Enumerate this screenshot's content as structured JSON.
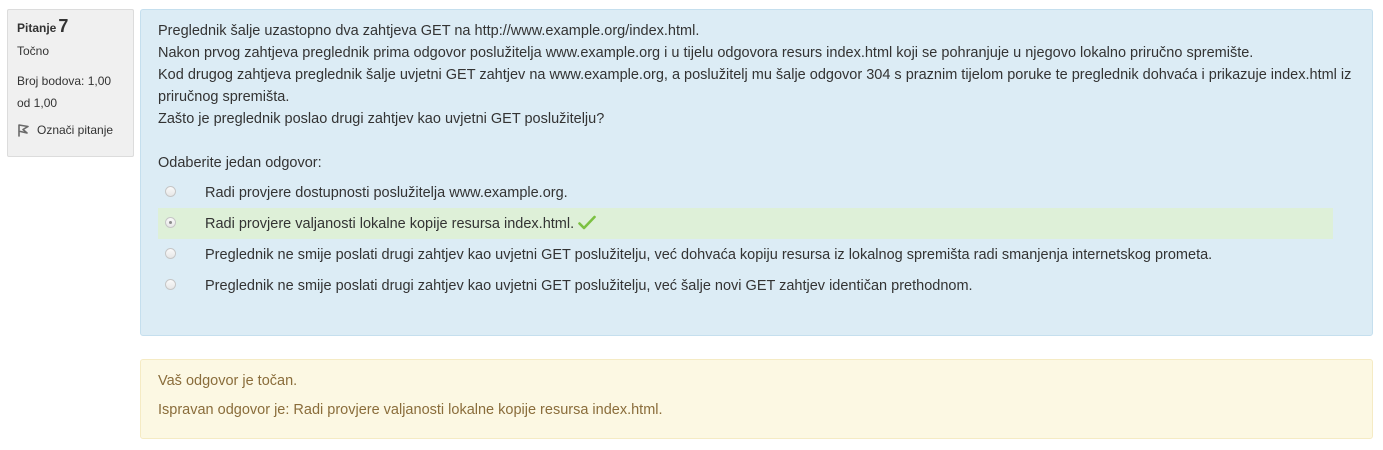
{
  "info": {
    "question_label": "Pitanje",
    "question_number": "7",
    "state": "Točno",
    "grade_line1": "Broj bodova: 1,00",
    "grade_line2": "od 1,00",
    "flag_label": "Označi pitanje",
    "flag_icon": "flag-icon"
  },
  "question": {
    "text_lines": [
      "Preglednik šalje uzastopno dva zahtjeva GET na http://www.example.org/index.html.",
      "Nakon prvog zahtjeva preglednik prima odgovor poslužitelja www.example.org i u tijelu odgovora resurs index.html koji se pohranjuje u njegovo lokalno priručno spremište.",
      "Kod drugog zahtjeva preglednik šalje uvjetni GET zahtjev na www.example.org, a poslužitelj mu šalje odgovor 304 s praznim tijelom poruke te preglednik dohvaća i prikazuje index.html iz priručnog spremišta.",
      "Zašto je preglednik poslao drugi zahtjev kao uvjetni GET poslužitelju?"
    ],
    "prompt": "Odaberite jedan odgovor:",
    "answers": [
      {
        "label": "Radi provjere dostupnosti poslužitelja www.example.org.",
        "selected": false,
        "correct": false
      },
      {
        "label": "Radi provjere valjanosti lokalne kopije resursa index.html.",
        "selected": true,
        "correct": true
      },
      {
        "label": "Preglednik ne smije poslati drugi zahtjev kao uvjetni GET poslužitelju, već dohvaća kopiju resursa iz lokalnog spremišta radi smanjenja internetskog prometa.",
        "selected": false,
        "correct": false
      },
      {
        "label": "Preglednik ne smije poslati drugi zahtjev kao uvjetni GET poslužitelju, već šalje novi GET zahtjev identičan prethodnom.",
        "selected": false,
        "correct": false
      }
    ],
    "check_icon": "checkmark-icon"
  },
  "feedback": {
    "general": "Vaš odgovor je točan.",
    "right_answer": "Ispravan odgovor je: Radi provjere valjanosti lokalne kopije resursa index.html."
  },
  "colors": {
    "question_bg": "#dcecf5",
    "correct_bg": "#def0d8",
    "feedback_bg": "#fcf8e3",
    "feedback_text": "#8a6d3b",
    "check": "#7cc142"
  }
}
